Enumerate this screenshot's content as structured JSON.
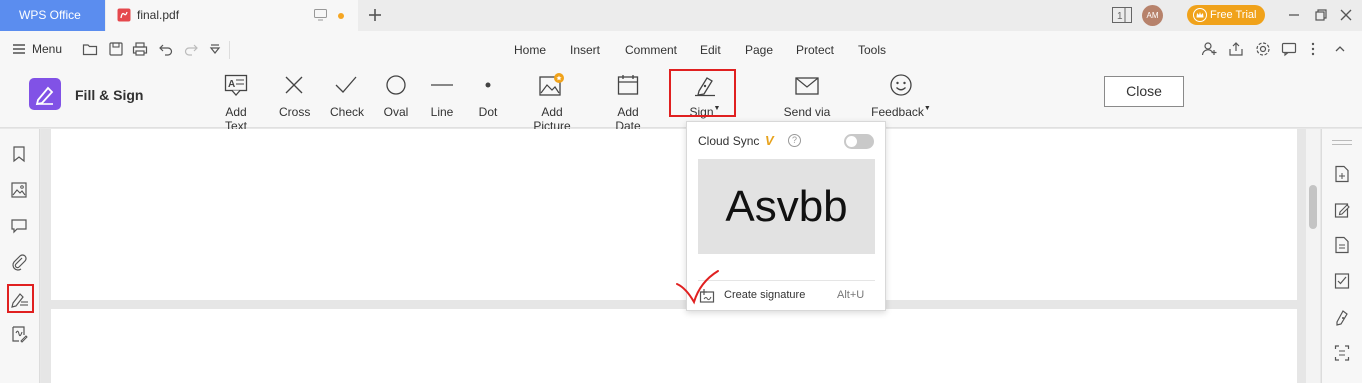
{
  "titlebar": {
    "app_tab": "WPS Office",
    "doc_tab": "final.pdf",
    "free_trial": "Free Trial",
    "avatar": "AM"
  },
  "menubar": {
    "menu_label": "Menu",
    "tabs": [
      "Home",
      "Insert",
      "Comment",
      "Edit",
      "Page",
      "Protect",
      "Tools"
    ]
  },
  "ribbon": {
    "title": "Fill & Sign",
    "tools": {
      "add_text": "Add Text",
      "cross": "Cross",
      "check": "Check",
      "oval": "Oval",
      "line": "Line",
      "dot": "Dot",
      "add_picture": "Add Picture",
      "add_date": "Add Date",
      "sign": "Sign",
      "send_email": "Send via email",
      "feedback": "Feedback"
    },
    "close": "Close"
  },
  "sign_dropdown": {
    "cloud_sync": "Cloud Sync",
    "vip": "V",
    "help": "?",
    "cloud_sync_enabled": false,
    "signature_preview": "Asvbb",
    "create_signature": "Create signature",
    "shortcut": "Alt+U"
  },
  "colors": {
    "wps_tab": "#5b8def",
    "highlight_red": "#e02020",
    "fill_sign_purple": "#8152e6",
    "free_trial": "#f0a21a"
  }
}
